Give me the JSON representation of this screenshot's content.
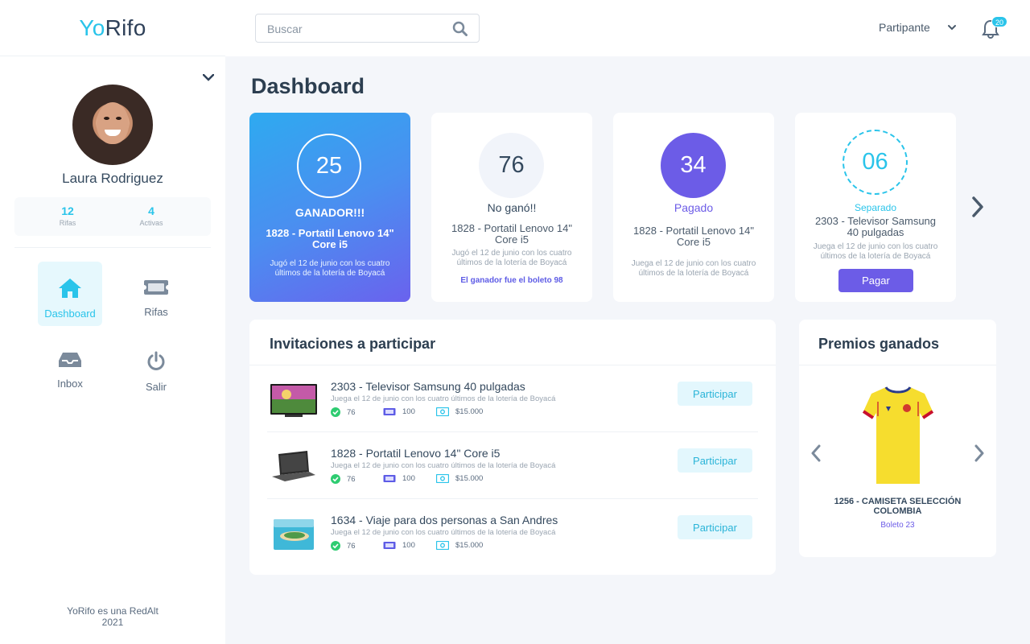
{
  "app": {
    "logo_yo": "Yo",
    "logo_rifo": "Rifo"
  },
  "user": {
    "name": "Laura Rodriguez"
  },
  "stats": [
    {
      "value": "12",
      "label": "Rifas"
    },
    {
      "value": "4",
      "label": "Activas"
    }
  ],
  "nav": [
    {
      "label": "Dashboard",
      "icon": "home-icon",
      "active": true
    },
    {
      "label": "Rifas",
      "icon": "ticket-icon"
    },
    {
      "label": "Inbox",
      "icon": "inbox-icon"
    },
    {
      "label": "Salir",
      "icon": "power-icon"
    }
  ],
  "footer": {
    "line1": "YoRifo es una RedAlt",
    "line2": "2021"
  },
  "topbar": {
    "search_placeholder": "Buscar",
    "role": "Partipante",
    "notifications": "20"
  },
  "page_title": "Dashboard",
  "raffle_cards": [
    {
      "number": "25",
      "status": "GANADOR!!!",
      "title": "1828 -  Portatil Lenovo 14\" Core i5",
      "description": "Jugó el 12 de junio con los cuatro últimos de la lotería de Boyacá"
    },
    {
      "number": "76",
      "status": "No ganó!!",
      "title": "1828 -  Portatil Lenovo 14\" Core i5",
      "description": "Jugó el 12 de junio con los cuatro últimos de la lotería de Boyacá",
      "note": "El ganador fue el boleto 98"
    },
    {
      "number": "34",
      "status": "Pagado",
      "title": "1828 -  Portatil Lenovo 14\" Core i5",
      "description": "Juega el 12 de junio con los cuatro últimos de la lotería de Boyacá"
    },
    {
      "number": "06",
      "status": "Separado",
      "title": "2303 -  Televisor Samsung 40 pulgadas",
      "description": "Juega el 12 de junio con los cuatro últimos de la lotería de Boyacá",
      "button": "Pagar"
    }
  ],
  "invitations": {
    "title": "Invitaciones a participar",
    "items": [
      {
        "title": "2303 -  Televisor Samsung 40 pulgadas",
        "description": "Juega el 12 de junio con los cuatro últimos de la lotería de Boyacá",
        "sold": "76",
        "total": "100",
        "price": "$15.000",
        "button": "Participar",
        "thumb": "tv"
      },
      {
        "title": "1828 -  Portatil Lenovo 14\" Core i5",
        "description": "Juega el 12 de junio con los cuatro últimos de la lotería de Boyacá",
        "sold": "76",
        "total": "100",
        "price": "$15.000",
        "button": "Participar",
        "thumb": "laptop"
      },
      {
        "title": "1634 -  Viaje para dos personas a San Andres",
        "description": "Juega el 12 de junio con los cuatro últimos de la lotería de Boyacá",
        "sold": "76",
        "total": "100",
        "price": "$15.000",
        "button": "Participar",
        "thumb": "beach"
      }
    ]
  },
  "prizes": {
    "title": "Premios ganados",
    "item": {
      "name": "1256 - CAMISETA SELECCIÓN COLOMBIA",
      "ticket": "Boleto 23"
    }
  },
  "colors": {
    "accent": "#2ac4ea",
    "purple": "#6c5ce7",
    "green": "#2ecc71"
  }
}
